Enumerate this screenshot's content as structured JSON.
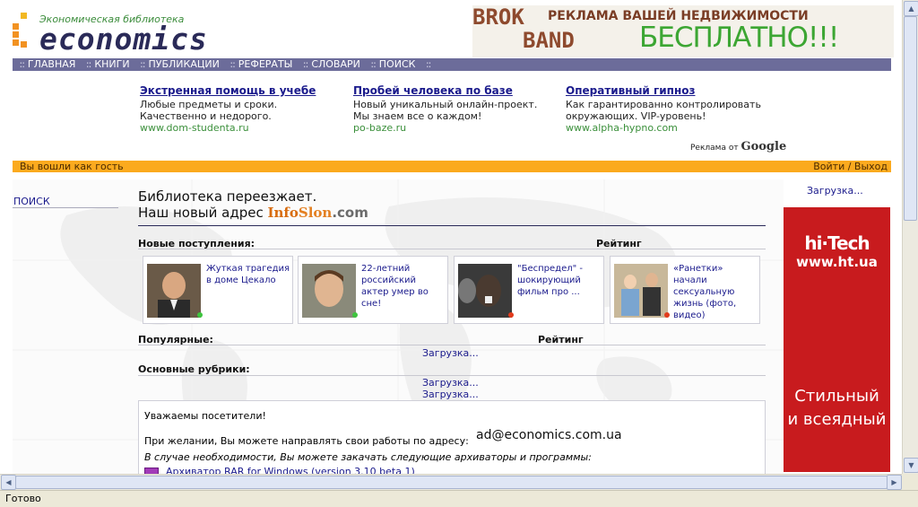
{
  "header": {
    "logo_subtitle": "Экономическая библиотека",
    "logo_text": "economics",
    "banner_left_top": "BROK",
    "banner_left_bottom": "BAND",
    "banner_title": "РЕКЛАМА ВАШЕЙ НЕДВИЖИМОСТИ",
    "banner_big": "БЕСПЛАТНО!!!"
  },
  "nav": {
    "items": [
      "ГЛАВНАЯ",
      "КНИГИ",
      "ПУБЛИКАЦИИ",
      "РЕФЕРАТЫ",
      "СЛОВАРИ",
      "ПОИСК"
    ],
    "separator": "::"
  },
  "ads": [
    {
      "title": "Экстренная помощь в учебе",
      "line1": "Любые предметы и сроки.",
      "line2": "Качественно и недорого.",
      "url": "www.dom-studenta.ru"
    },
    {
      "title": "Пробей человека по базе",
      "line1": "Новый уникальный онлайн-проект.",
      "line2": "Мы знаем все о каждом!",
      "url": "po-baze.ru"
    },
    {
      "title": "Оперативный гипноз",
      "line1": "Как гарантированно контролировать",
      "line2": "окружающих. VIP-уровень!",
      "url": "www.alpha-hypno.com"
    }
  ],
  "ads_by": {
    "prefix": "Реклама от",
    "brand": "Google"
  },
  "userbar": {
    "guest": "Вы вошли как гость",
    "login": "Войти / Выход"
  },
  "left": {
    "search_label": "ПОИСК"
  },
  "main": {
    "move_line1": "Библиотека переезжает.",
    "move_line2_prefix": "Наш новый адрес",
    "site_info": "Info",
    "site_slon": "Slon",
    "site_com": ".com",
    "new_label": "Новые поступления:",
    "rating_label": "Рейтинг",
    "cards": [
      {
        "text": "Жуткая трагедия в доме Цекало"
      },
      {
        "text": "22-летний российский актер умер во сне!"
      },
      {
        "text": "\"Беспредел\" - шокирующий фильм про ..."
      },
      {
        "text": "«Ранетки» начали сексуальную жизнь (фото, видео)"
      }
    ],
    "popular_label": "Популярные:",
    "rating_label_2": "Рейтинг",
    "loading": "Загрузка...",
    "rubrics_label": "Основные рубрики:",
    "notice": {
      "greeting": "Уважаемы посетители!",
      "send_text": "При желании, Вы можете направлять свои работы по адресу:",
      "email": "ad@economics.com.ua",
      "archivers_text": "В случае необходимости, Вы можете закачать следующие архиваторы и программы:",
      "archiver_item": "Архиватор RAR for Windows (version 3.10 beta 1)"
    }
  },
  "right": {
    "loading": "Загрузка...",
    "banner_logo": "hi·Tech",
    "banner_url": "www.ht.ua",
    "banner_slogan1": "Стильный",
    "banner_slogan2": "и всеядный"
  },
  "statusbar": {
    "text": "Готово"
  },
  "colors": {
    "nav_bg": "#6c6c9a",
    "userbar_bg": "#fbaa1e",
    "ad_link": "#1a1a8c",
    "ad_url": "#3a8f3a",
    "hitech_red": "#c81b1e"
  }
}
